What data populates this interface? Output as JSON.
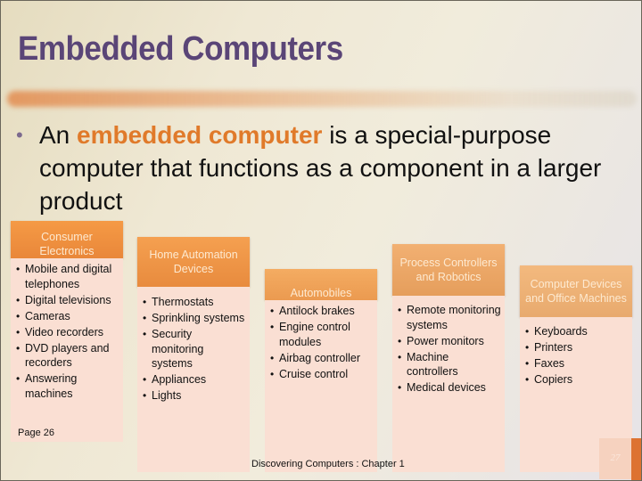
{
  "slide": {
    "title": "Embedded Computers",
    "bullet": {
      "prefix": "An ",
      "highlight": "embedded computer",
      "suffix": " is a special-purpose computer that functions as a component in a larger product"
    },
    "categories": [
      {
        "title": "Consumer Electronics",
        "items": [
          "Mobile and digital telephones",
          "Digital televisions",
          "Cameras",
          "Video recorders",
          "DVD players and recorders",
          "Answering machines"
        ]
      },
      {
        "title": "Home Automation Devices",
        "items": [
          "Thermostats",
          "Sprinkling systems",
          "Security monitoring systems",
          "Appliances",
          "Lights"
        ]
      },
      {
        "title": "Automobiles",
        "items": [
          "Antilock brakes",
          "Engine control modules",
          "Airbag controller",
          "Cruise control"
        ]
      },
      {
        "title": "Process Controllers and Robotics",
        "items": [
          "Remote monitoring systems",
          "Power monitors",
          "Machine controllers",
          "Medical devices"
        ]
      },
      {
        "title": "Computer Devices and Office Machines",
        "items": [
          "Keyboards",
          "Printers",
          "Faxes",
          "Copiers"
        ]
      }
    ],
    "page_ref": "Page 26",
    "footer": "Discovering Computers : Chapter 1",
    "slide_number": "27"
  },
  "colors": {
    "title": "#5a4577",
    "highlight": "#e07a2a",
    "box_body": "#fadfd3",
    "accent_strip": "#dd7231"
  }
}
